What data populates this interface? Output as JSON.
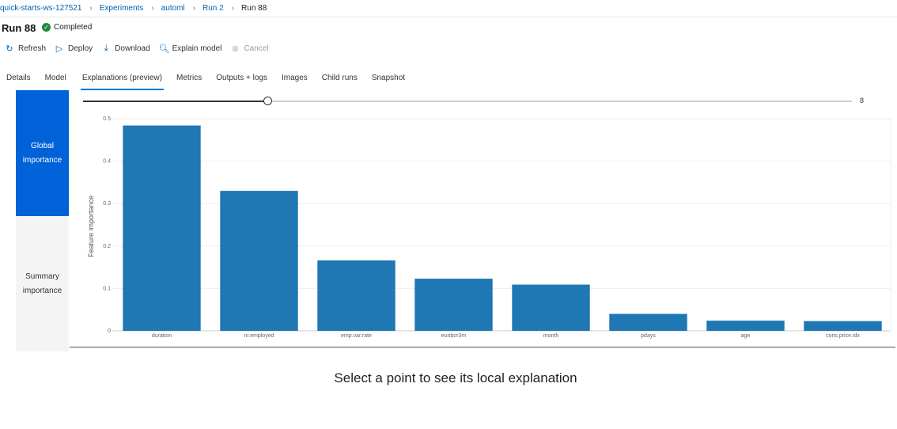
{
  "breadcrumb": [
    "quick-starts-ws-127521",
    "Experiments",
    "automl",
    "Run 2",
    "Run 88"
  ],
  "run": {
    "title": "Run 88",
    "status": "Completed"
  },
  "toolbar": {
    "refresh": "Refresh",
    "deploy": "Deploy",
    "download": "Download",
    "explain": "Explain model",
    "cancel": "Cancel"
  },
  "tabs": [
    "Details",
    "Model",
    "Explanations (preview)",
    "Metrics",
    "Outputs + logs",
    "Images",
    "Child runs",
    "Snapshot"
  ],
  "active_tab": "Explanations (preview)",
  "side_nav": {
    "global": "Global importance",
    "summary": "Summary importance"
  },
  "slider": {
    "value": "8",
    "fraction": 0.24
  },
  "chart_data": {
    "type": "bar",
    "categories": [
      "duration",
      "nr.employed",
      "emp.var.rate",
      "euribor3m",
      "month",
      "pdays",
      "age",
      "cons.price.idx"
    ],
    "values": [
      0.484,
      0.33,
      0.166,
      0.123,
      0.109,
      0.04,
      0.024,
      0.023
    ],
    "ylabel": "Feature importance",
    "yticks": [
      "0",
      "0.1",
      "0.2",
      "0.3",
      "0.4",
      "0.5"
    ],
    "ylim": [
      0,
      0.5
    ],
    "bar_color": "#1f77b4",
    "grid": true
  },
  "message": "Select a point to see its local explanation",
  "colors": {
    "accent": "#0078d4",
    "nav_active": "#0062d9",
    "success": "#1e8a3e"
  }
}
